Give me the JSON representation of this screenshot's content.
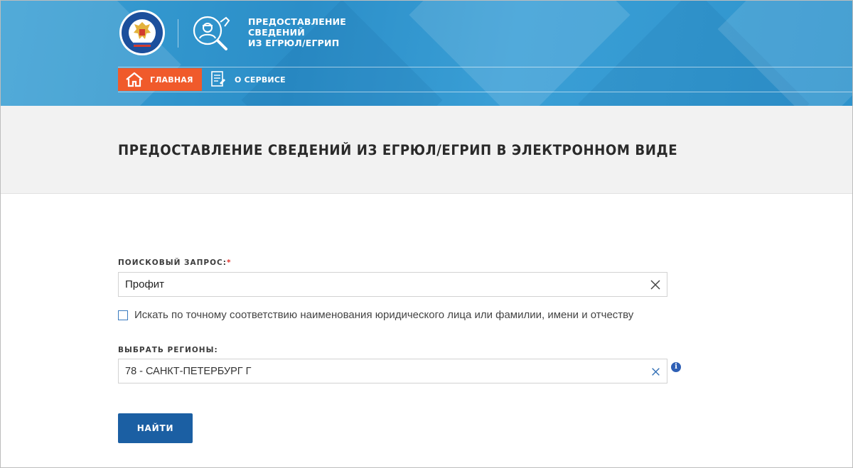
{
  "header": {
    "emblem_icon": "fns-emblem-icon",
    "service_icon": "inspector-magnifier-icon",
    "service_title_lines": [
      "ПРЕДОСТАВЛЕНИЕ",
      "СВЕДЕНИЙ",
      "ИЗ ЕГРЮЛ/ЕГРИП"
    ],
    "colors": {
      "primary": "#2b8ec8",
      "accent": "#f05a2b"
    }
  },
  "nav": {
    "home_label": "ГЛАВНАЯ",
    "home_icon": "home-icon",
    "about_label": "О СЕРВИСЕ",
    "about_icon": "document-icon"
  },
  "page": {
    "title": "ПРЕДОСТАВЛЕНИЕ СВЕДЕНИЙ ИЗ ЕГРЮЛ/ЕГРИП В ЭЛЕКТРОННОМ ВИДЕ"
  },
  "form": {
    "query_label": "ПОИСКОВЫЙ ЗАПРОС:",
    "query_required_mark": "*",
    "query_value": "Профит",
    "exact_match_checked": false,
    "exact_match_label": "Искать по точному соответствию наименования юридического лица или фамилии, имени и отчеству",
    "regions_label": "ВЫБРАТЬ РЕГИОНЫ:",
    "regions_value": "78 - САНКТ-ПЕТЕРБУРГ Г",
    "info_icon": "info-icon",
    "submit_label": "НАЙТИ",
    "submit_color": "#1b5fa3"
  }
}
